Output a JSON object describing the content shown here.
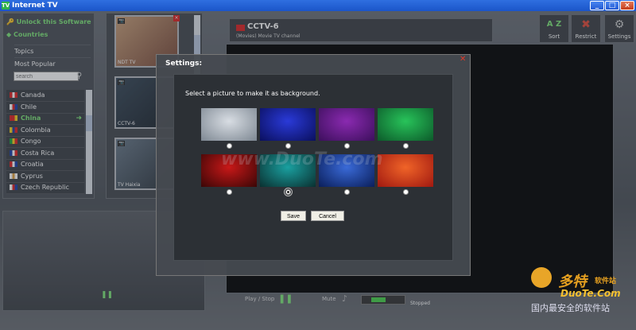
{
  "window": {
    "title": "Internet TV",
    "icon": "tv-logo-icon"
  },
  "sidebar": {
    "unlock_label": "Unlock this Software",
    "countries_label": "Countries",
    "topics_label": "Topics",
    "most_popular_label": "Most Popular",
    "search_placeholder": "search",
    "countries": [
      {
        "name": "Canada",
        "flag_colors": [
          "#d22",
          "#fff",
          "#d22"
        ],
        "selected": false
      },
      {
        "name": "Chile",
        "flag_colors": [
          "#fff",
          "#d22",
          "#1a3ea8"
        ],
        "selected": false
      },
      {
        "name": "China",
        "flag_colors": [
          "#d22",
          "#d22",
          "#f5d020"
        ],
        "selected": true
      },
      {
        "name": "Colombia",
        "flag_colors": [
          "#f5d020",
          "#1a3ea8",
          "#d22"
        ],
        "selected": false
      },
      {
        "name": "Congo",
        "flag_colors": [
          "#1aa040",
          "#f5d020",
          "#d22"
        ],
        "selected": false
      },
      {
        "name": "Costa Rica",
        "flag_colors": [
          "#1a3ea8",
          "#fff",
          "#d22"
        ],
        "selected": false
      },
      {
        "name": "Croatia",
        "flag_colors": [
          "#d22",
          "#fff",
          "#1a3ea8"
        ],
        "selected": false
      },
      {
        "name": "Cyprus",
        "flag_colors": [
          "#fff",
          "#e0a040",
          "#fff"
        ],
        "selected": false
      },
      {
        "name": "Czech Republic",
        "flag_colors": [
          "#fff",
          "#d22",
          "#1a3ea8"
        ],
        "selected": false
      }
    ]
  },
  "channels": [
    {
      "caption": "NDT TV",
      "tint": [
        "#c9a07a",
        "#7a4a3a"
      ]
    },
    {
      "caption": "CCTV-6",
      "tint": [
        "#3a4a5a",
        "#1a222a"
      ]
    },
    {
      "caption": "TV Haixia",
      "tint": [
        "#6a7a8a",
        "#2a323a"
      ]
    }
  ],
  "player": {
    "channel_name": "CCTV-6",
    "channel_desc": "(Movies) Movie TV channel",
    "play_stop_label": "Play / Stop",
    "mute_label": "Mute",
    "status": "Stopped",
    "volume_level": 0.45
  },
  "toolbar": {
    "sort_label": "Sort",
    "sort_icon_text": "A Z",
    "restrict_label": "Restrict",
    "settings_label": "Settings"
  },
  "settings": {
    "title": "Settings:",
    "prompt": "Select a picture to make it as background.",
    "save_label": "Save",
    "cancel_label": "Cancel",
    "selected_index": 5,
    "backgrounds": [
      {
        "name": "silver-haze",
        "colors": [
          "#d8dde3",
          "#7d8792"
        ]
      },
      {
        "name": "blue-wave",
        "colors": [
          "#2a3ad8",
          "#0a0f5e"
        ]
      },
      {
        "name": "purple-bokeh",
        "colors": [
          "#8a2ab0",
          "#3c0f5c"
        ]
      },
      {
        "name": "green-aurora",
        "colors": [
          "#28c35a",
          "#0c5a2a"
        ]
      },
      {
        "name": "red-glow",
        "colors": [
          "#c81818",
          "#3a0606"
        ]
      },
      {
        "name": "teal-wave",
        "colors": [
          "#1aa0a0",
          "#0a3030"
        ]
      },
      {
        "name": "blue-tiles",
        "colors": [
          "#3a6ad8",
          "#0a1e5a"
        ]
      },
      {
        "name": "autumn-leaves",
        "colors": [
          "#f06428",
          "#a01810"
        ]
      }
    ]
  },
  "watermarks": {
    "center": "www.DuoTe.com",
    "logo": "多特",
    "logo_sub": "软件站",
    "site": "DuoTe.Com",
    "slogan": "国内最安全的软件站"
  }
}
